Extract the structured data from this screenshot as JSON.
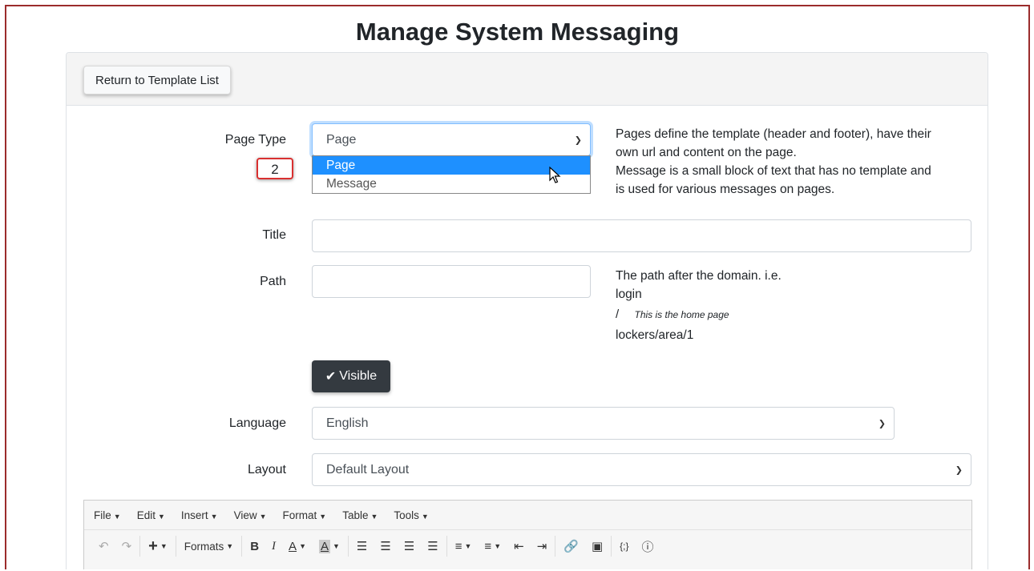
{
  "page": {
    "title": "Manage System Messaging"
  },
  "header": {
    "return_label": "Return to Template List"
  },
  "page_type": {
    "label": "Page Type",
    "selected": "Page",
    "options": [
      "Page",
      "Message"
    ],
    "help_lines": [
      "Pages define the template (header and footer), have their",
      "own url and content on the page.",
      "Message is a small block of text that has no template and",
      "is used for various messages on pages."
    ]
  },
  "step_badge": "2",
  "title_field": {
    "label": "Title",
    "value": ""
  },
  "path_field": {
    "label": "Path",
    "value": "",
    "help_intro": "The path after the domain. i.e.",
    "examples": [
      "login",
      "/",
      "lockers/area/1"
    ],
    "home_note": "This is the home page"
  },
  "visible_button": {
    "label": "Visible"
  },
  "language": {
    "label": "Language",
    "selected": "English"
  },
  "layout": {
    "label": "Layout",
    "selected": "Default Layout"
  },
  "editor": {
    "menus": [
      "File",
      "Edit",
      "Insert",
      "View",
      "Format",
      "Table",
      "Tools"
    ],
    "formats_label": "Formats"
  },
  "colors": {
    "frame_border": "#9b2c2c",
    "dropdown_highlight": "#1e90ff",
    "badge_border": "#d93030",
    "dark_button": "#343a40"
  }
}
